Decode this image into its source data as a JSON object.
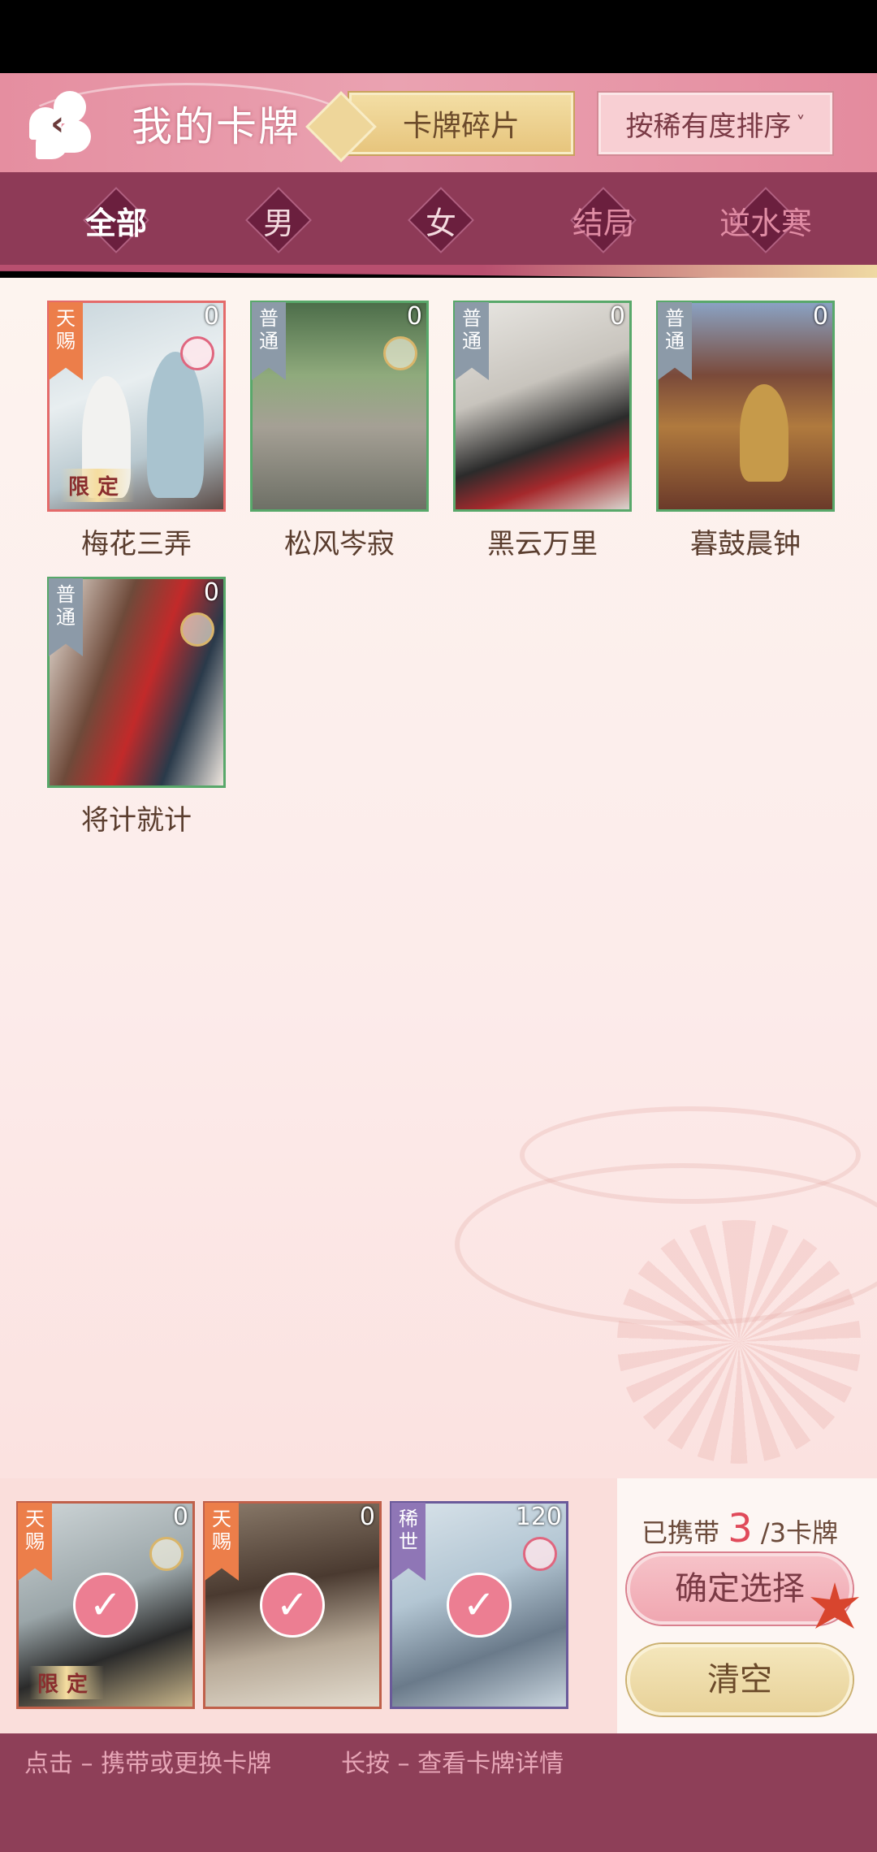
{
  "header": {
    "title": "我的卡牌",
    "switch_label": "卡牌碎片",
    "sort_label": "按稀有度排序",
    "sort_chevron": "˅"
  },
  "filters": [
    {
      "label": "全部",
      "active": true
    },
    {
      "label": "男"
    },
    {
      "label": "女"
    },
    {
      "label": "结局"
    },
    {
      "label": "逆水寒"
    }
  ],
  "cards": [
    {
      "name": "梅花三弄",
      "count": "0",
      "rarity": "天赐",
      "limited": "限定"
    },
    {
      "name": "松风岑寂",
      "count": "0",
      "rarity": "普通"
    },
    {
      "name": "黑云万里",
      "count": "0",
      "rarity": "普通"
    },
    {
      "name": "暮鼓晨钟",
      "count": "0",
      "rarity": "普通"
    },
    {
      "name": "将计就计",
      "count": "0",
      "rarity": "普通"
    }
  ],
  "carried_cards": [
    {
      "count": "0",
      "rarity": "天赐",
      "limited": "限定",
      "check": "✓"
    },
    {
      "count": "0",
      "rarity": "天赐",
      "check": "✓"
    },
    {
      "count": "120",
      "rarity": "稀世",
      "check": "✓"
    }
  ],
  "carry_status": {
    "prefix": "已携带",
    "current": "3",
    "suffix": "/3卡牌"
  },
  "buttons": {
    "confirm": "确定选择",
    "clear": "清空"
  },
  "hints": {
    "tap": "点击 – 携带或更换卡牌",
    "long_press": "长按 – 查看卡牌详情"
  },
  "icons": {
    "back": "back-arrow-icon",
    "swap": "swap-arrows-icon",
    "check": "checkmark-icon"
  },
  "colors": {
    "accent": "#e04a5a",
    "header_pink": "#e58ea0",
    "filter_bar": "#8e3a57",
    "footer": "#8e3f58"
  }
}
